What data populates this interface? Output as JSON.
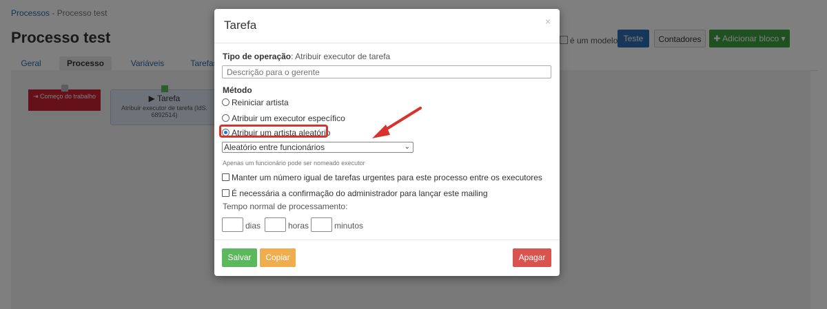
{
  "breadcrumb": {
    "root": "Processos",
    "separator": " - ",
    "current": "Processo test"
  },
  "page": {
    "title": "Processo test",
    "model_label": "é um modelo",
    "btn_teste": "Teste",
    "btn_contadores": "Contadores",
    "btn_add": "Adicionar bloco",
    "add_icon": "plus-icon",
    "add_caret": "▾"
  },
  "tabs": [
    {
      "label": "Geral"
    },
    {
      "label": "Processo"
    },
    {
      "label": "Variáveis"
    },
    {
      "label": "Tarefas"
    }
  ],
  "canvas": {
    "start_block": {
      "label": "Começo do trabalho",
      "icon": "login-icon"
    },
    "task_block": {
      "title": "Tarefa",
      "icon": "play-icon",
      "subtitle": "Atribuir executor de tarefa (IdS. 6892514)"
    }
  },
  "modal": {
    "title": "Tarefa",
    "close": "×",
    "op_label": "Tipo de operação",
    "op_value": ": Atribuir executor de tarefa",
    "desc_placeholder": "Descrição para o gerente",
    "metodo_label": "Método",
    "radios": [
      {
        "label": "Reiniciar artista",
        "checked": false
      },
      {
        "label": "Atribuir um executor específico",
        "checked": false
      },
      {
        "label": "Atribuir um artista aleatório",
        "checked": true
      }
    ],
    "select_value": "Aleatório entre funcionários",
    "hint": "Apenas um funcionário pode ser nomeado executor",
    "checkboxes": [
      {
        "label": "Manter um número igual de tarefas urgentes para este processo entre os executores"
      },
      {
        "label": "É necessária a confirmação do administrador para lançar este mailing"
      }
    ],
    "tempo_label": "Tempo normal de processamento:",
    "time_units": {
      "days": "dias",
      "hours": "horas",
      "minutes": "minutos"
    },
    "buttons": {
      "save": "Salvar",
      "copy": "Copiar",
      "delete": "Apagar"
    }
  },
  "colors": {
    "primary": "#2f6eb5",
    "success": "#5cb85c",
    "warning": "#f0ad4e",
    "danger": "#d9534f",
    "annotation": "#d9322c"
  }
}
